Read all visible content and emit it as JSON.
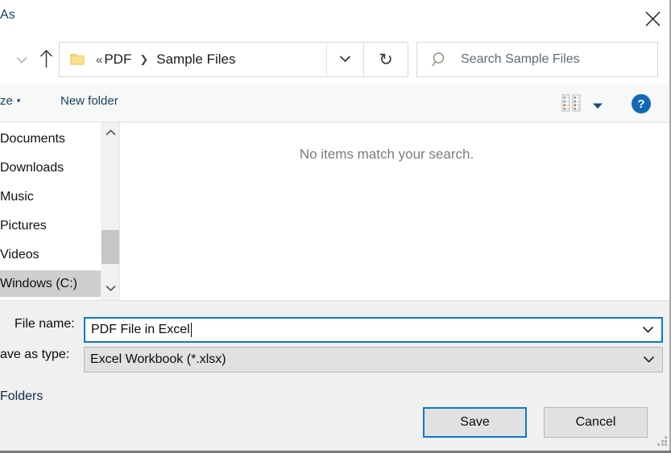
{
  "window": {
    "title": "As",
    "close_label": "close-icon"
  },
  "nav": {
    "recent_locations_icon": "chevron-down-icon",
    "up_icon": "arrow-up-icon",
    "folder_icon": "folder-icon",
    "overflow_chevrons": "«",
    "breadcrumbs": [
      {
        "label": "PDF"
      },
      {
        "label": "Sample Files"
      }
    ],
    "breadcrumb_separator": "❯",
    "address_dropdown_icon": "chevron-down-icon",
    "refresh_icon": "↻"
  },
  "search": {
    "placeholder": "Search Sample Files",
    "icon": "search-icon"
  },
  "toolbar": {
    "organize_label": "ze",
    "organize_caret": "▾",
    "new_folder_label": "New folder",
    "view_mode_icon": "view-details-icon",
    "view_caret": "▾",
    "help_label": "?"
  },
  "sidebar": {
    "items": [
      {
        "label": "Documents",
        "selected": false
      },
      {
        "label": "Downloads",
        "selected": false
      },
      {
        "label": "Music",
        "selected": false
      },
      {
        "label": "Pictures",
        "selected": false
      },
      {
        "label": "Videos",
        "selected": false
      },
      {
        "label": "Windows (C:)",
        "selected": true
      }
    ],
    "scroll_up_icon": "chevron-up-icon",
    "scroll_down_icon": "chevron-down-icon"
  },
  "file_list": {
    "empty_message": "No items match your search."
  },
  "form": {
    "file_name_label": "File name:",
    "file_name_value": "PDF File in Excel",
    "save_as_type_label": "ave as type:",
    "save_as_type_value": "Excel Workbook (*.xlsx)",
    "dropdown_icon": "chevron-down-icon"
  },
  "footer": {
    "hide_folders_label": "Folders",
    "save_label": "Save",
    "cancel_label": "Cancel",
    "resize_grip": "resize-grip"
  },
  "colors": {
    "accent": "#0a7ad1",
    "help_blue": "#1268b3",
    "toolbar_bg": "#f7f8f8",
    "form_bg": "#f0f0f0",
    "selected_row": "#cfcfcf"
  }
}
